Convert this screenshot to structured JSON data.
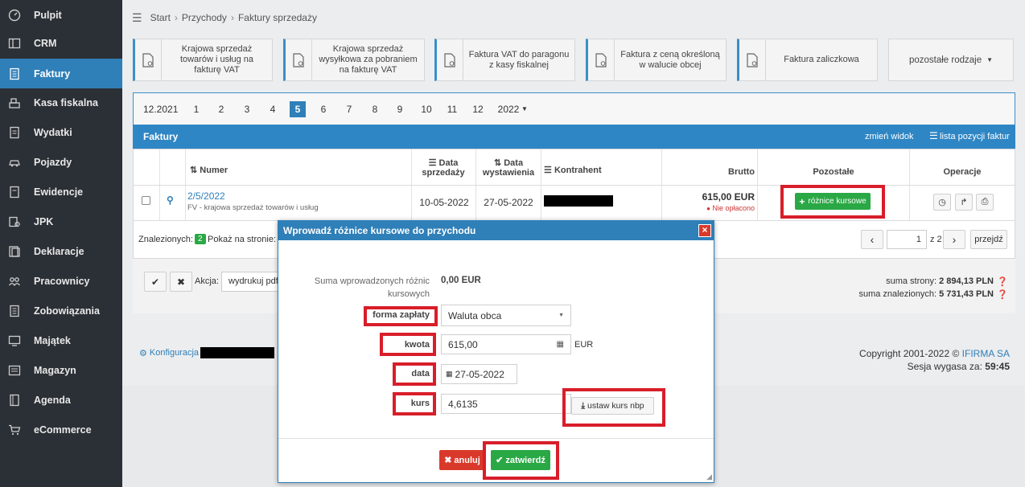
{
  "sidebar": {
    "items": [
      {
        "label": "Pulpit",
        "icon": "dashboard-icon"
      },
      {
        "label": "CRM",
        "icon": "crm-icon"
      },
      {
        "label": "Faktury",
        "icon": "invoice-icon"
      },
      {
        "label": "Kasa fiskalna",
        "icon": "cash-register-icon"
      },
      {
        "label": "Wydatki",
        "icon": "expenses-icon"
      },
      {
        "label": "Pojazdy",
        "icon": "car-icon"
      },
      {
        "label": "Ewidencje",
        "icon": "records-icon"
      },
      {
        "label": "JPK",
        "icon": "jpk-icon"
      },
      {
        "label": "Deklaracje",
        "icon": "declarations-icon"
      },
      {
        "label": "Pracownicy",
        "icon": "employees-icon"
      },
      {
        "label": "Zobowiązania",
        "icon": "liabilities-icon"
      },
      {
        "label": "Majątek",
        "icon": "assets-icon"
      },
      {
        "label": "Magazyn",
        "icon": "warehouse-icon"
      },
      {
        "label": "Agenda",
        "icon": "agenda-icon"
      },
      {
        "label": "eCommerce",
        "icon": "cart-icon"
      }
    ],
    "active_index": 2
  },
  "breadcrumb": {
    "items": [
      "Start",
      "Przychody",
      "Faktury sprzedaży"
    ]
  },
  "invoice_types": [
    {
      "label": "Krajowa sprzedaż towarów i usług na fakturę VAT"
    },
    {
      "label": "Krajowa sprzedaż wysyłkowa za pobraniem na fakturę VAT"
    },
    {
      "label": "Faktura VAT do paragonu z kasy fiskalnej"
    },
    {
      "label": "Faktura z ceną określoną w walucie obcej"
    },
    {
      "label": "Faktura zaliczkowa"
    }
  ],
  "more_types_label": "pozostałe rodzaje",
  "month_pager": {
    "prev_label": "12.2021",
    "months": [
      "1",
      "2",
      "3",
      "4",
      "5",
      "6",
      "7",
      "8",
      "9",
      "10",
      "11",
      "12"
    ],
    "current": "5",
    "next_year": "2022"
  },
  "table": {
    "title": "Faktury",
    "change_view": "zmień widok",
    "positions_list": "lista pozycji faktur",
    "headers": {
      "numer": "Numer",
      "data_sprzedazy": "Data sprzedaży",
      "data_wystawienia": "Data wystawienia",
      "kontrahent": "Kontrahent",
      "brutto": "Brutto",
      "pozostale": "Pozostałe",
      "operacje": "Operacje"
    },
    "rows": [
      {
        "numer": "2/5/2022",
        "opis": "FV - krajowa sprzedaż towarów i usług",
        "data_sprzedazy": "10-05-2022",
        "data_wystawienia": "27-05-2022",
        "brutto": "615,00 EUR",
        "status": "Nie opłacono",
        "action_label": "różnice kursowe"
      }
    ]
  },
  "footer_row": {
    "znalezionych_label": "Znalezionych:",
    "znalezionych_count": "2",
    "pokaz_label": "Pokaż na stronie:",
    "page_value": "1",
    "page_total": "z 2",
    "go_label": "przejdź"
  },
  "actions": {
    "akcja_label": "Akcja:",
    "akcja_value": "wydrukuj pdf",
    "suma_strony_label": "suma strony:",
    "suma_strony_value": "2 894,13 PLN",
    "suma_znalezionych_label": "suma znalezionych:",
    "suma_znalezionych_value": "5 731,43 PLN"
  },
  "footer": {
    "konfiguracja": "Konfiguracja",
    "copyright": "Copyright 2001-2022 ©",
    "brand": "IFIRMA SA",
    "session_label": "Sesja wygasa za:",
    "session_value": "59:45"
  },
  "modal": {
    "title": "Wprowadź różnice kursowe do przychodu",
    "summary_label": "Suma wprowadzonych różnic kursowych",
    "summary_value": "0,00 EUR",
    "forma_label": "forma zapłaty",
    "forma_value": "Waluta obca",
    "kwota_label": "kwota",
    "kwota_value": "615,00",
    "kwota_currency": "EUR",
    "data_label": "data",
    "data_value": "27-05-2022",
    "kurs_label": "kurs",
    "kurs_value": "4,6135",
    "nbp_button": "ustaw kurs nbp",
    "cancel_button": "anuluj",
    "confirm_button": "zatwierdź"
  },
  "colors": {
    "sidebar_bg": "#2b3036",
    "accent_blue": "#2f7fb8",
    "green": "#2aa845",
    "red_highlight": "#d81e2a"
  }
}
